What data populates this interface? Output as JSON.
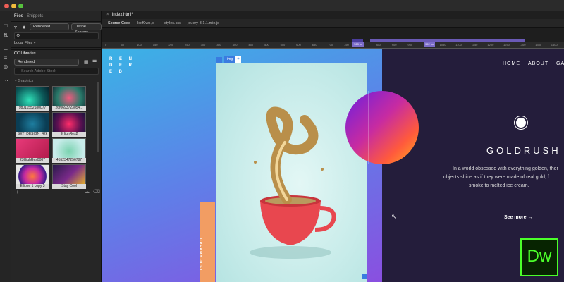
{
  "window": {
    "doc_tab": "index.html*"
  },
  "panel": {
    "tabs": [
      "Files",
      "Snippets"
    ],
    "site_select": "Rendered",
    "define_servers": "Define Servers",
    "local_files": "Local Files ▾",
    "cc_libraries_title": "CC Libraries",
    "library_select": "Rendered",
    "search_placeholder": "Search Adobe Stock",
    "graphics_heading": "▾ Graphics",
    "thumbs": [
      {
        "label": "9b011552180077"
      },
      {
        "label": "26f0693723054..."
      },
      {
        "label": "SET_DESIGN_42k"
      },
      {
        "label": "9HighRes2"
      },
      {
        "label": "23HighRes0087"
      },
      {
        "label": "4552347256787"
      },
      {
        "label": "Ellipse 1 copy 3"
      },
      {
        "label": "Stay Cool"
      }
    ]
  },
  "related_files": [
    "Source Code",
    "lcxf0wn.js",
    "styles.css",
    "jquery-3.1.1.min.js"
  ],
  "ruler": {
    "ticks": [
      "0",
      "50",
      "100",
      "150",
      "200",
      "250",
      "300",
      "350",
      "400",
      "450",
      "500",
      "550",
      "600",
      "650",
      "700",
      "750",
      "800",
      "850",
      "900",
      "950",
      "1000",
      "1050",
      "1100",
      "1150",
      "1200",
      "1250",
      "1300",
      "1350",
      "1400",
      "1450"
    ],
    "mq_left": "768 px",
    "mq_right": "992 px"
  },
  "page": {
    "logo_lines": [
      "R  E  N",
      "D  E  R",
      "E  D  _"
    ],
    "img_badge": "img",
    "vertical_text": "CREAMY JUST",
    "nav": [
      "HOME",
      "ABOUT",
      "GA"
    ],
    "title": "GOLDRUSH",
    "paragraph": [
      "In a world obsessed with everything golden, ther",
      "objects shine as if they were made of real gold, f",
      "smoke to melted ice cream."
    ],
    "see_more": "See more →"
  },
  "app_badge": "Dw",
  "colors": {
    "accent_blue": "#3a7be0",
    "dw_green": "#4bff2a",
    "dw_bg": "#072401",
    "right_bg": "#241d3b"
  }
}
